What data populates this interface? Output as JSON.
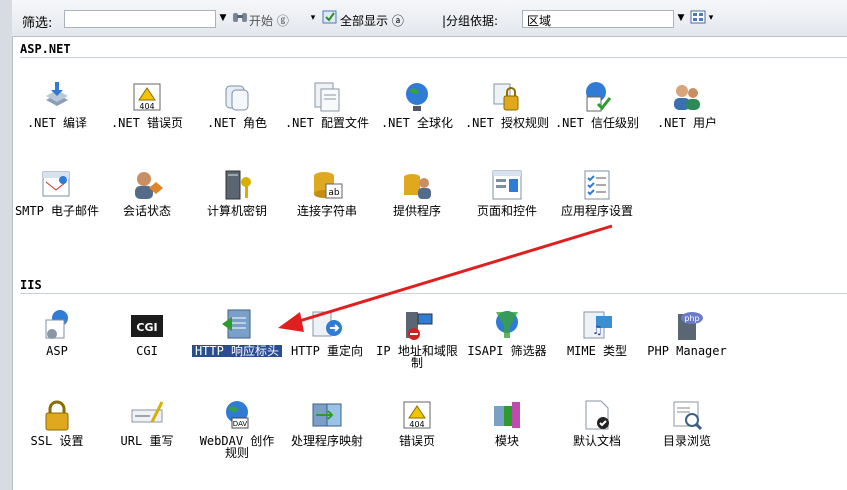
{
  "toolbar": {
    "filter_label": "筛选:",
    "start_label": "开始 ⓖ",
    "show_all_label": "全部显示 ⓐ",
    "group_by_label": "|分组依据:",
    "group_by_value": "区域"
  },
  "sections": {
    "aspnet": {
      "header": "ASP.NET",
      "items": [
        {
          "label": ".NET 编译",
          "icon": "compile-icon"
        },
        {
          "label": ".NET 错误页",
          "icon": "error-page-icon"
        },
        {
          "label": ".NET 角色",
          "icon": "roles-icon"
        },
        {
          "label": ".NET 配置文件",
          "icon": "profile-icon"
        },
        {
          "label": ".NET 全球化",
          "icon": "globe-icon"
        },
        {
          "label": ".NET 授权规则",
          "icon": "authorization-icon"
        },
        {
          "label": ".NET 信任级别",
          "icon": "trust-level-icon"
        },
        {
          "label": ".NET 用户",
          "icon": "users-icon"
        },
        {
          "label": "SMTP 电子邮件",
          "icon": "smtp-icon"
        },
        {
          "label": "会话状态",
          "icon": "session-state-icon"
        },
        {
          "label": "计算机密钥",
          "icon": "machine-key-icon"
        },
        {
          "label": "连接字符串",
          "icon": "connection-strings-icon"
        },
        {
          "label": "提供程序",
          "icon": "providers-icon"
        },
        {
          "label": "页面和控件",
          "icon": "pages-controls-icon"
        },
        {
          "label": "应用程序设置",
          "icon": "app-settings-icon"
        }
      ]
    },
    "iis": {
      "header": "IIS",
      "items": [
        {
          "label": "ASP",
          "icon": "asp-icon"
        },
        {
          "label": "CGI",
          "icon": "cgi-icon"
        },
        {
          "label": "HTTP 响应标头",
          "icon": "http-headers-icon"
        },
        {
          "label": "HTTP 重定向",
          "icon": "http-redirect-icon"
        },
        {
          "label": "IP 地址和域限制",
          "icon": "ip-restrictions-icon"
        },
        {
          "label": "ISAPI 筛选器",
          "icon": "isapi-filters-icon"
        },
        {
          "label": "MIME 类型",
          "icon": "mime-types-icon"
        },
        {
          "label": "PHP Manager",
          "icon": "php-manager-icon"
        },
        {
          "label": "SSL 设置",
          "icon": "ssl-lock-icon"
        },
        {
          "label": "URL 重写",
          "icon": "url-rewrite-icon"
        },
        {
          "label": "WebDAV 创作规则",
          "icon": "webdav-icon"
        },
        {
          "label": "处理程序映射",
          "icon": "handler-mappings-icon"
        },
        {
          "label": "错误页",
          "icon": "error-pages-icon"
        },
        {
          "label": "模块",
          "icon": "modules-icon"
        },
        {
          "label": "默认文档",
          "icon": "default-document-icon"
        },
        {
          "label": "目录浏览",
          "icon": "directory-browsing-icon"
        }
      ]
    }
  },
  "selected_item": "HTTP 响应标头",
  "colors": {
    "selection": "#2a4d8f",
    "annotation_arrow": "#e02020"
  }
}
